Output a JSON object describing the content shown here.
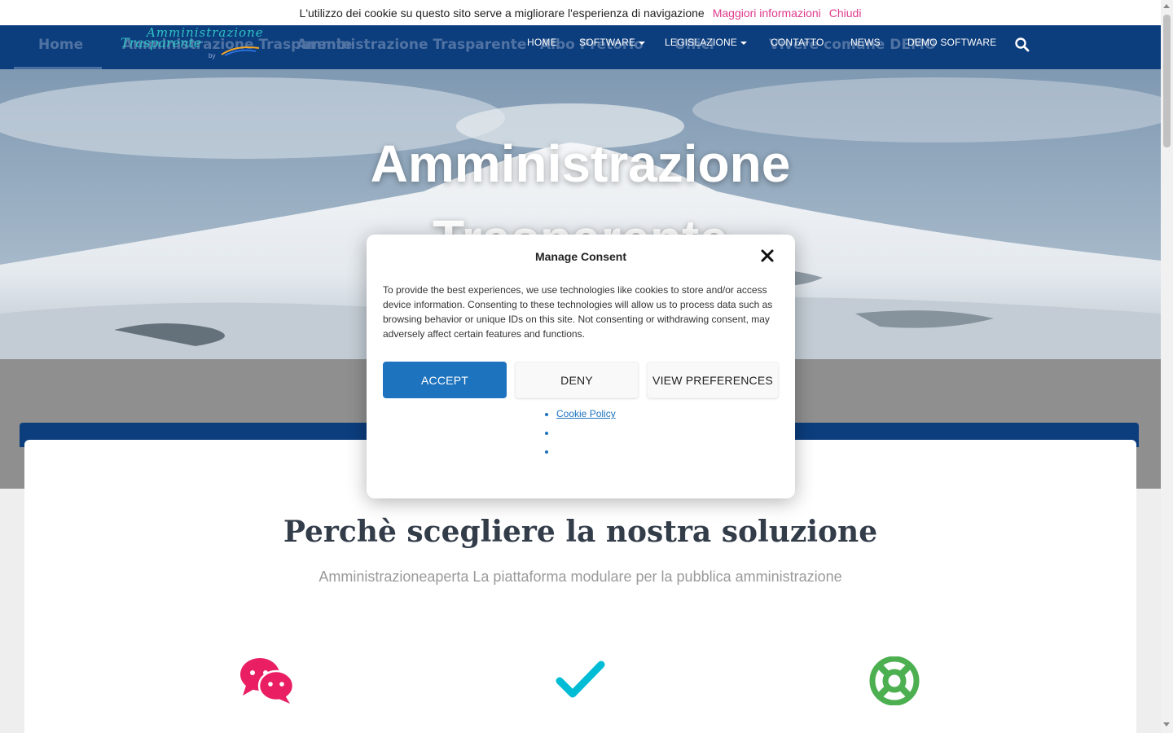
{
  "cookie_bar": {
    "message": "L'utilizzo dei cookie su questo sito serve a migliorare l'esperienza di navigazione",
    "more_info": "Maggiori informazioni",
    "close": "Chiudi"
  },
  "navbar": {
    "background_menu": [
      "Home",
      "Amministrazione Trasparente",
      "Amministrazione Trasparente",
      "Albo Pretorio",
      "Uffici",
      "Vivere comune DEMO"
    ],
    "logo": {
      "line1": "Amministrazione",
      "line2": "Trasparente",
      "line3": "by"
    },
    "links": [
      {
        "label": "HOME",
        "dropdown": false
      },
      {
        "label": "SOFTWARE",
        "dropdown": true
      },
      {
        "label": "LEGISLAZIONE",
        "dropdown": true
      },
      {
        "label": "CONTATTO",
        "dropdown": false
      },
      {
        "label": "NEWS",
        "dropdown": false
      },
      {
        "label": "DEMO SOFTWARE",
        "dropdown": false
      }
    ],
    "search_icon": "search-icon"
  },
  "hero": {
    "title_line1": "Amministrazione",
    "title_line2": "Trasparente"
  },
  "section": {
    "title": "Perchè scegliere la nostra soluzione",
    "subtitle": "Amministrazioneaperta La piattaforma modulare per la pubblica amministrazione",
    "features": [
      {
        "icon": "chat-bubbles-icon",
        "color": "#e91e63"
      },
      {
        "icon": "checkmark-icon",
        "color": "#00bcd4"
      },
      {
        "icon": "lifebuoy-icon",
        "color": "#4caf50"
      }
    ]
  },
  "modal": {
    "title": "Manage Consent",
    "text": "To provide the best experiences, we use technologies like cookies to store and/or access device information. Consenting to these technologies will allow us to process data such as browsing behavior or unique IDs on this site. Not consenting or withdrawing consent, may adversely affect certain features and functions.",
    "accept_label": "ACCEPT",
    "deny_label": "DENY",
    "preferences_label": "VIEW PREFERENCES",
    "links": [
      "Cookie Policy",
      "",
      ""
    ]
  },
  "colors": {
    "nav_blue": "#0c3d7d",
    "accept_blue": "#1e73be",
    "cookie_link_pink": "#e03a8c"
  }
}
